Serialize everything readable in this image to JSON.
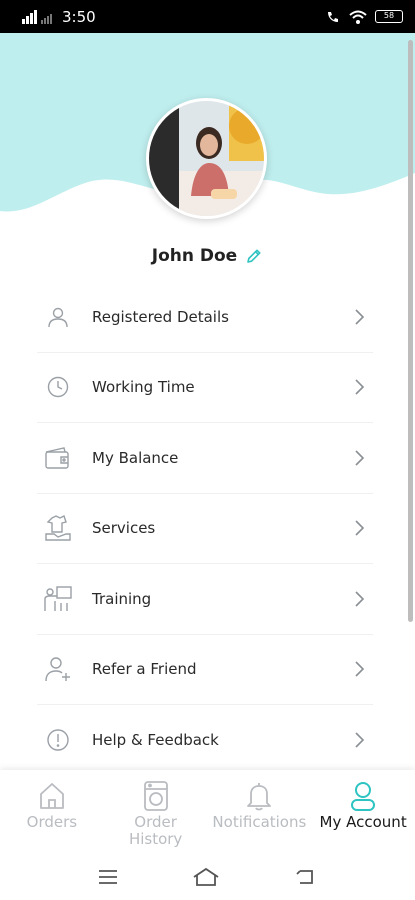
{
  "status_bar": {
    "time": "3:50",
    "battery": "58"
  },
  "profile": {
    "name": "John Doe"
  },
  "menu": {
    "items": [
      {
        "label": "Registered Details",
        "icon": "user-icon"
      },
      {
        "label": "Working Time",
        "icon": "clock-icon"
      },
      {
        "label": "My Balance",
        "icon": "wallet-icon"
      },
      {
        "label": "Services",
        "icon": "services-icon"
      },
      {
        "label": "Training",
        "icon": "training-icon"
      },
      {
        "label": "Refer a Friend",
        "icon": "add-user-icon"
      },
      {
        "label": "Help & Feedback",
        "icon": "info-icon"
      }
    ]
  },
  "bottom_nav": {
    "orders": "Orders",
    "order_history_line1": "Order",
    "order_history_line2": "History",
    "notifications": "Notifications",
    "my_account": "My Account"
  },
  "colors": {
    "accent": "#2ec4c1",
    "header_bg": "#bfeeee",
    "inactive": "#b9bcc0"
  }
}
